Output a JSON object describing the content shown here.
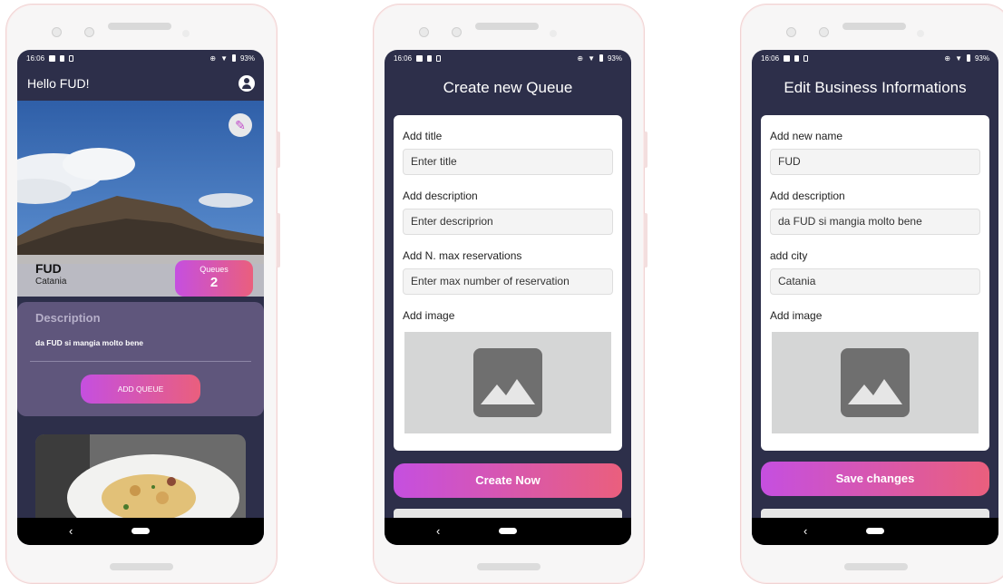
{
  "status_bar": {
    "time": "16:06",
    "battery": "93%"
  },
  "home": {
    "greeting": "Hello FUD!",
    "business_name": "FUD",
    "city": "Catania",
    "queues_label": "Queues",
    "queues_count": "2",
    "description_title": "Description",
    "description_text": "da FUD si mangia molto bene",
    "add_queue_label": "ADD QUEUE"
  },
  "create_queue": {
    "title": "Create new Queue",
    "title_label": "Add title",
    "title_placeholder": "Enter title",
    "description_label": "Add description",
    "description_placeholder": "Enter descriprion",
    "max_label": "Add N. max reservations",
    "max_placeholder": "Enter max number of reservation",
    "image_label": "Add image",
    "submit_label": "Create Now"
  },
  "edit_business": {
    "title": "Edit Business Informations",
    "name_label": "Add new name",
    "name_value": "FUD",
    "description_label": "Add description",
    "description_value": "da FUD si mangia molto bene",
    "city_label": "add city",
    "city_value": "Catania",
    "image_label": "Add image",
    "submit_label": "Save changes"
  },
  "navbar": {
    "back_glyph": "‹"
  },
  "colors": {
    "screen_bg": "#2d2f4a",
    "gradient_start": "#c54fe0",
    "gradient_end": "#ea5f7d",
    "description_card": "#5f567c"
  }
}
